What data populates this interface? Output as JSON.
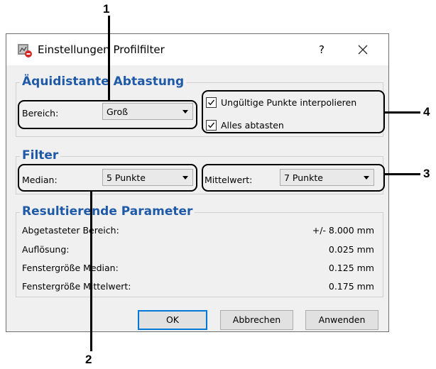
{
  "window": {
    "title": "Einstellungen Profilfilter",
    "help_label": "?",
    "icons": {
      "app": "profile-filter-app-icon",
      "close": "close-icon"
    }
  },
  "equidistant": {
    "title": "Äquidistante Abtastung",
    "range_label": "Bereich:",
    "range_value": "Groß",
    "interpolate_label": "Ungültige Punkte interpolieren",
    "interpolate_checked": true,
    "scan_all_label": "Alles abtasten",
    "scan_all_checked": true
  },
  "filter": {
    "title": "Filter",
    "median_label": "Median:",
    "median_value": "5 Punkte",
    "mean_label": "Mittelwert:",
    "mean_value": "7 Punkte"
  },
  "results": {
    "title": "Resultierende Parameter",
    "rows": [
      {
        "label": "Abgetasteter Bereich:",
        "value": "+/- 8.000 mm"
      },
      {
        "label": "Auflösung:",
        "value": "0.025 mm"
      },
      {
        "label": "Fenstergröße Median:",
        "value": "0.125 mm"
      },
      {
        "label": "Fenstergröße Mittelwert:",
        "value": "0.175 mm"
      }
    ]
  },
  "buttons": {
    "ok": "OK",
    "cancel": "Abbrechen",
    "apply": "Anwenden"
  },
  "callouts": [
    "1",
    "2",
    "3",
    "4"
  ],
  "colors": {
    "group_title": "#1f5aa8",
    "dialog_bg": "#f0f0f0",
    "default_button_border": "#0078d7"
  }
}
